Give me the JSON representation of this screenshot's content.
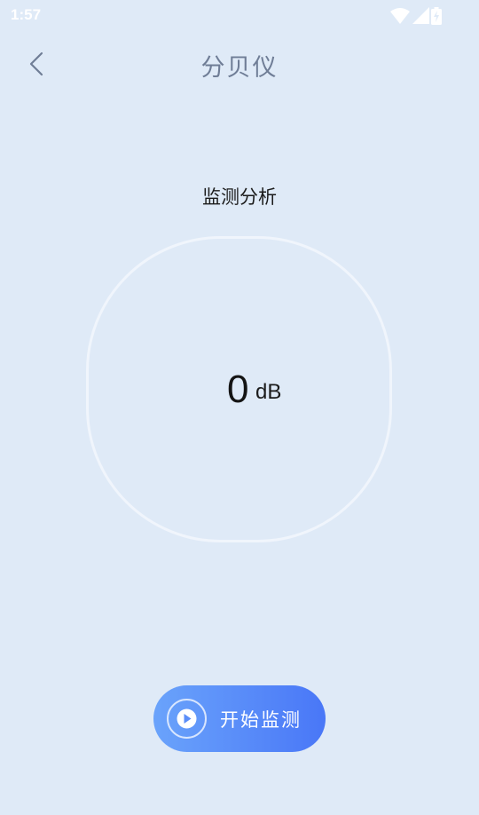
{
  "status_bar": {
    "time": "1:57",
    "icons": [
      "wifi-icon",
      "cellular-signal-icon",
      "battery-charging-icon"
    ]
  },
  "header": {
    "title": "分贝仪",
    "back_icon": "chevron-left-icon"
  },
  "main": {
    "section_title": "监测分析",
    "reading": {
      "value": "0",
      "unit": "dB"
    }
  },
  "action": {
    "start_label": "开始监测",
    "icon": "play-icon"
  },
  "colors": {
    "background": "#dfeaf7",
    "title_text": "#6f7d96",
    "button_gradient_start": "#6aa3fb",
    "button_gradient_end": "#4977f7"
  }
}
